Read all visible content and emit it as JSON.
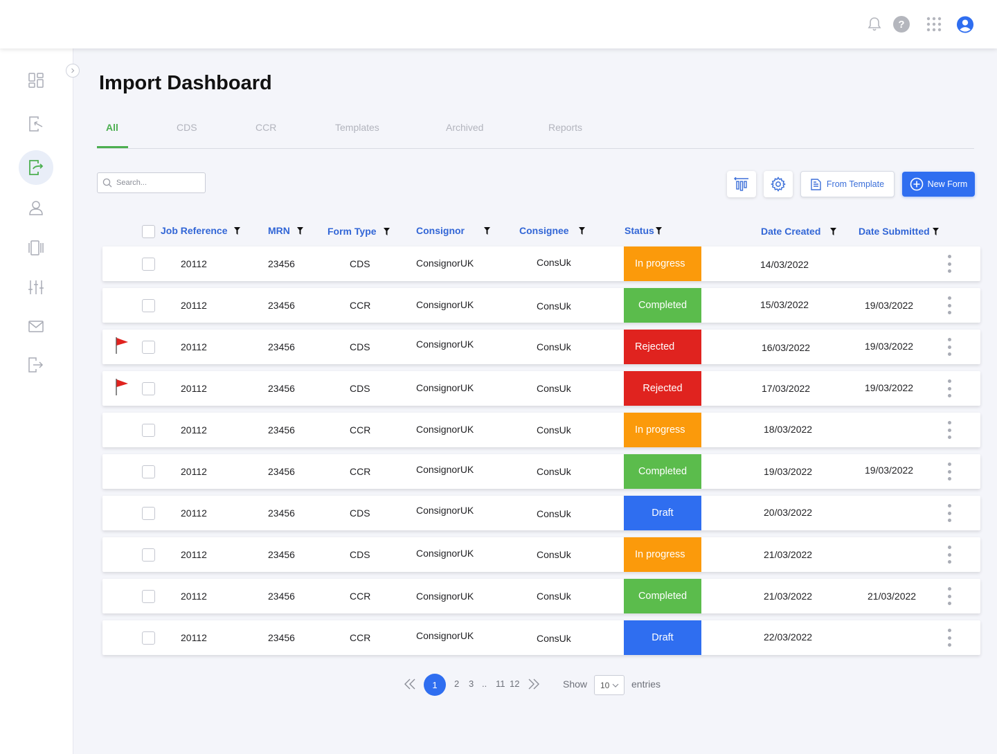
{
  "page": {
    "title": "Import Dashboard"
  },
  "tabs": [
    {
      "label": "All",
      "active": true
    },
    {
      "label": "CDS"
    },
    {
      "label": "CCR"
    },
    {
      "label": "Templates"
    },
    {
      "label": "Archived"
    },
    {
      "label": "Reports"
    }
  ],
  "toolbar": {
    "search_placeholder": "Search...",
    "from_template_label": "From Template",
    "new_form_label": "New Form"
  },
  "table": {
    "headers": {
      "job_reference": "Job Reference",
      "mrn": "MRN",
      "form_type": "Form Type",
      "consignor": "Consignor",
      "consignee": "Consignee",
      "status": "Status",
      "date_created": "Date Created",
      "date_submitted": "Date Submitted"
    },
    "rows": [
      {
        "flag": false,
        "job_ref": "20112",
        "mrn": "23456",
        "form_type": "CDS",
        "consignor": "ConsignorUK",
        "consignee": "ConsUk",
        "status": "In progress",
        "date_created": "14/03/2022",
        "date_submitted": ""
      },
      {
        "flag": false,
        "job_ref": "20112",
        "mrn": "23456",
        "form_type": "CCR",
        "consignor": "ConsignorUK",
        "consignee": "ConsUk",
        "status": "Completed",
        "date_created": "15/03/2022",
        "date_submitted": "19/03/2022"
      },
      {
        "flag": true,
        "job_ref": "20112",
        "mrn": "23456",
        "form_type": "CDS",
        "consignor": "ConsignorUK",
        "consignee": "ConsUk",
        "status": "Rejected",
        "date_created": "16/03/2022",
        "date_submitted": "19/03/2022"
      },
      {
        "flag": true,
        "job_ref": "20112",
        "mrn": "23456",
        "form_type": "CDS",
        "consignor": "ConsignorUK",
        "consignee": "ConsUk",
        "status": "Rejected",
        "date_created": "17/03/2022",
        "date_submitted": "19/03/2022"
      },
      {
        "flag": false,
        "job_ref": "20112",
        "mrn": "23456",
        "form_type": "CCR",
        "consignor": "ConsignorUK",
        "consignee": "ConsUk",
        "status": "In progress",
        "date_created": "18/03/2022",
        "date_submitted": ""
      },
      {
        "flag": false,
        "job_ref": "20112",
        "mrn": "23456",
        "form_type": "CCR",
        "consignor": "ConsignorUK",
        "consignee": "ConsUk",
        "status": "Completed",
        "date_created": "19/03/2022",
        "date_submitted": "19/03/2022"
      },
      {
        "flag": false,
        "job_ref": "20112",
        "mrn": "23456",
        "form_type": "CDS",
        "consignor": "ConsignorUK",
        "consignee": "ConsUk",
        "status": "Draft",
        "date_created": "20/03/2022",
        "date_submitted": ""
      },
      {
        "flag": false,
        "job_ref": "20112",
        "mrn": "23456",
        "form_type": "CDS",
        "consignor": "ConsignorUK",
        "consignee": "ConsUk",
        "status": "In progress",
        "date_created": "21/03/2022",
        "date_submitted": ""
      },
      {
        "flag": false,
        "job_ref": "20112",
        "mrn": "23456",
        "form_type": "CCR",
        "consignor": "ConsignorUK",
        "consignee": "ConsUk",
        "status": "Completed",
        "date_created": "21/03/2022",
        "date_submitted": "21/03/2022"
      },
      {
        "flag": false,
        "job_ref": "20112",
        "mrn": "23456",
        "form_type": "CCR",
        "consignor": "ConsignorUK",
        "consignee": "ConsUk",
        "status": "Draft",
        "date_created": "22/03/2022",
        "date_submitted": ""
      }
    ]
  },
  "status_colors": {
    "In progress": "#fb9a0b",
    "Completed": "#5bbc4c",
    "Rejected": "#e0231f",
    "Draft": "#2f6ef0"
  },
  "colors": {
    "accent_blue": "#2f6ef0",
    "accent_green": "#4caf50",
    "flag_red": "#e0231f"
  },
  "pagination": {
    "current": "1",
    "pages": [
      "2",
      "3",
      "..",
      "11",
      "12"
    ],
    "show_label": "Show",
    "page_size": "10",
    "entries_label": "entries"
  },
  "icons": {
    "topbar": [
      "bell-icon",
      "help-icon",
      "apps-grid-icon",
      "user-avatar-icon"
    ],
    "sidebar": [
      "dashboard-icon",
      "import-icon",
      "export-icon",
      "user-icon",
      "document-icon",
      "sliders-icon",
      "mail-icon",
      "logout-icon"
    ]
  }
}
